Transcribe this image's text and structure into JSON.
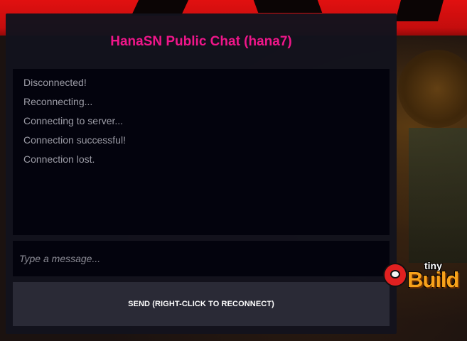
{
  "chat": {
    "title": "HanaSN Public Chat (hana7)",
    "messages": [
      "Disconnected!",
      "Reconnecting...",
      "Connecting to server...",
      "Connection successful!",
      "Connection lost."
    ],
    "input": {
      "value": "",
      "placeholder": "Type a message..."
    },
    "send_label": "SEND (RIGHT-CLICK TO RECONNECT)"
  },
  "logo": {
    "text_top": "tiny",
    "text_main": "Build"
  },
  "colors": {
    "title": "#f0168a",
    "panel": "#13131d",
    "log_background": "#03030d",
    "send_button": "#2a2a36",
    "message_text": "#9c9ca6"
  }
}
